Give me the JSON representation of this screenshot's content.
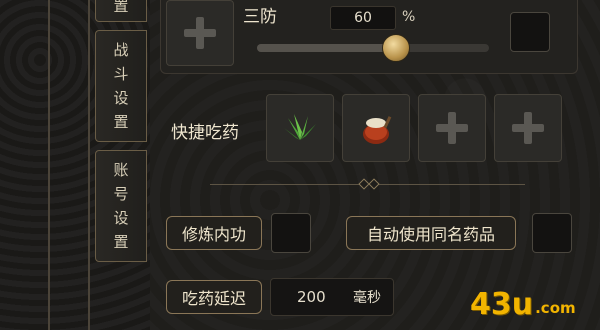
{
  "sidebar": {
    "tabs": [
      {
        "label": "置"
      },
      {
        "label": "战斗设置"
      },
      {
        "label": "账号设置"
      }
    ]
  },
  "defense": {
    "label": "三防",
    "percent_value": "60",
    "percent_unit": "%",
    "slider_level": 0.6
  },
  "quick_medicine": {
    "label": "快捷吃药",
    "slots": [
      {
        "icon": "herb-icon",
        "filled": true
      },
      {
        "icon": "potion-pot-icon",
        "filled": true
      },
      {
        "icon": "plus-icon",
        "filled": false
      },
      {
        "icon": "plus-icon",
        "filled": false
      }
    ]
  },
  "options": {
    "cultivate_label": "修炼内功",
    "auto_same_name_label": "自动使用同名药品"
  },
  "delay": {
    "label": "吃药延迟",
    "value": "200",
    "unit": "毫秒"
  },
  "watermark": {
    "text_main": "43u",
    "text_suffix": ".com"
  },
  "colors": {
    "gold_border": "#8a7657",
    "knob": "#c9a35a",
    "watermark": "#f2b400"
  }
}
